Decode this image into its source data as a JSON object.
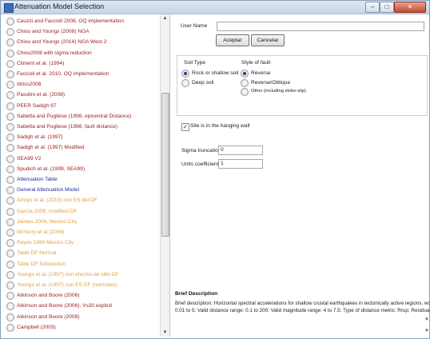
{
  "window": {
    "title": "Attenuation Model Selection",
    "controls": {
      "minimize": "–",
      "maximize": "□",
      "close": "✕"
    }
  },
  "models": [
    {
      "label": "Cauzzi and Faccioli 2008, OQ implementation",
      "color": "red"
    },
    {
      "label": "Chiou and Youngs (2008) NGA",
      "color": "red"
    },
    {
      "label": "Chiou and Youngs (2014) NGA West 2",
      "color": "red"
    },
    {
      "label": "Chiou2008 with sigma reduction",
      "color": "red"
    },
    {
      "label": "Climent et al. (1994)",
      "color": "red"
    },
    {
      "label": "Faccioli et al. 2010, OQ implementation",
      "color": "red"
    },
    {
      "label": "Idriss2008",
      "color": "red"
    },
    {
      "label": "Pasolini et al. (2008)",
      "color": "red"
    },
    {
      "label": "PEER Sadigh 97",
      "color": "red"
    },
    {
      "label": "Sabetta and Pugliese (1996, epicentral Distance)",
      "color": "red"
    },
    {
      "label": "Sabetta and Pugliese (1996, fault distance)",
      "color": "red"
    },
    {
      "label": "Sadigh et al. (1997)",
      "color": "red"
    },
    {
      "label": "Sadigh et al. (1997) Modified",
      "color": "red"
    },
    {
      "label": "SEA99 V2",
      "color": "red"
    },
    {
      "label": "Spudich et al. (1999, SEA99)",
      "color": "red"
    },
    {
      "label": "Attenuation Table",
      "color": "blue"
    },
    {
      "label": "General Attenuation Model",
      "color": "blue"
    },
    {
      "label": "Arroyo et al. (2010) con ES del DF",
      "color": "orange"
    },
    {
      "label": "García 2005, modified DF",
      "color": "orange"
    },
    {
      "label": "Jaimes 2006, Mexico City",
      "color": "orange"
    },
    {
      "label": "McVerry et al (2006)",
      "color": "orange"
    },
    {
      "label": "Reyes 1999 Mexico City",
      "color": "orange"
    },
    {
      "label": "Table DF Normal",
      "color": "orange"
    },
    {
      "label": "Table DF Subduction",
      "color": "orange"
    },
    {
      "label": "Youngs et al. (1997) con efectos de sitio DF",
      "color": "orange"
    },
    {
      "label": "Youngs et al. (1997) con ES DF (normales)",
      "color": "orange"
    },
    {
      "label": "Atkinson and Boore (2006)",
      "color": "red"
    },
    {
      "label": "Atkinson and Boore (2006), Vs30 explicit",
      "color": "red"
    },
    {
      "label": "Atkinson and Boore (2008)",
      "color": "red"
    },
    {
      "label": "Campbell (2003)",
      "color": "red"
    }
  ],
  "colors": {
    "red": "#a02020",
    "blue": "#1e2f9e",
    "orange": "#e0a03a"
  },
  "form": {
    "user_name_label": "User Name",
    "user_name_value": "",
    "accept_label": "Aceptar",
    "cancel_label": "Cancelar",
    "soil_type": {
      "title": "Soil Type",
      "options": [
        "Rock or shallow soil",
        "Deep soil"
      ],
      "selected": "Rock or shallow soil"
    },
    "style_of_fault": {
      "title": "Style of fault",
      "options": [
        "Reverse",
        "Reverse/Oblique",
        "Other (including strike-slip)"
      ],
      "selected": "Reverse"
    },
    "hanging_wall": {
      "label": "Site is in the hanging wall",
      "checked": true
    },
    "sigma_truncation_label": "Sigma truncation",
    "sigma_truncation_value": "0",
    "units_coefficient_label": "Units coefficient",
    "units_coefficient_value": "1"
  },
  "brief": {
    "title": "Brief Description",
    "line1": "Brief description: Horizontal spectral accelerations for shallow crustal earthquakes in tectonically active regions, world-wide. Origin",
    "line2": "0.01 to 5; Valid distance range: 0.1 to 200; Valid magnitude range: 4 to 7.5; Type of distance metric: Rrup; Residuals distribution: L"
  }
}
